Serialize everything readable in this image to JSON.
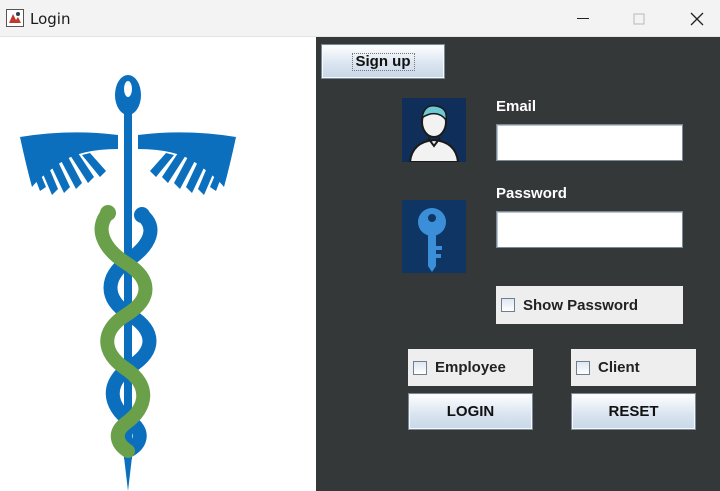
{
  "window": {
    "title": "Login",
    "icon": "java-app-icon"
  },
  "logo": {
    "icon": "caduceus-medical-icon",
    "colors": {
      "blue": "#0b6fbd",
      "green": "#6aa04a"
    }
  },
  "header": {
    "signup_label": "Sign up"
  },
  "form": {
    "email_label": "Email",
    "email_value": "",
    "email_icon": "user-avatar-icon",
    "password_label": "Password",
    "password_value": "",
    "password_icon": "key-icon",
    "show_password_label": "Show Password",
    "show_password_checked": false
  },
  "roles": {
    "employee_label": "Employee",
    "employee_checked": false,
    "client_label": "Client",
    "client_checked": false
  },
  "actions": {
    "login_label": "LOGIN",
    "reset_label": "RESET"
  },
  "colors": {
    "panel_background": "#353839",
    "button_gradient_top": "#ffffff",
    "button_gradient_bottom": "#c9d7e7",
    "checkbox_background": "#eeeeee"
  }
}
